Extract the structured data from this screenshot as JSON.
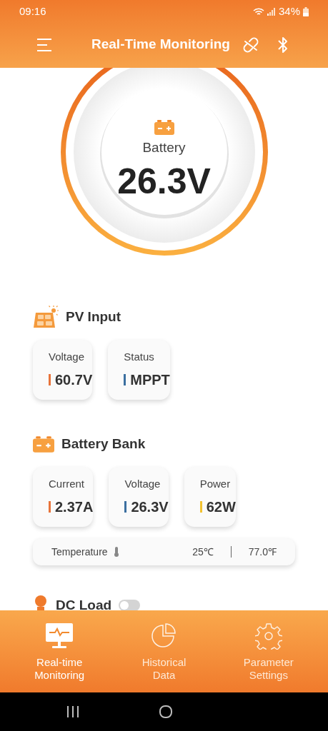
{
  "status_bar": {
    "time": "09:16",
    "battery": "34%"
  },
  "header": {
    "title": "Real-Time Monitoring"
  },
  "gauge": {
    "label": "Battery",
    "value": "26.3V"
  },
  "sections": [
    {
      "kind": "pv",
      "title": "PV Input",
      "metrics": [
        {
          "label": "Voltage",
          "value": "60.7V",
          "color": "#e8743b"
        },
        {
          "label": "Status",
          "value": "MPPT",
          "color": "#3b6fa0"
        }
      ]
    },
    {
      "kind": "battery",
      "title": "Battery Bank",
      "metrics": [
        {
          "label": "Current",
          "value": "2.37A",
          "color": "#e8743b"
        },
        {
          "label": "Voltage",
          "value": "26.3V",
          "color": "#3b6fa0"
        },
        {
          "label": "Power",
          "value": "62W",
          "color": "#f2c230"
        }
      ],
      "temperature": {
        "label": "Temperature",
        "celsius": "25℃",
        "fahrenheit": "77.0℉"
      }
    },
    {
      "kind": "load",
      "title": "DC Load",
      "toggle": {
        "on": false
      }
    }
  ],
  "tabs": [
    {
      "label": "Real-time Monitoring",
      "kind": "monitor",
      "selected": true
    },
    {
      "label": "Historical Data",
      "kind": "chart",
      "selected": false
    },
    {
      "label": "Parameter Settings",
      "kind": "gear",
      "selected": false
    }
  ]
}
